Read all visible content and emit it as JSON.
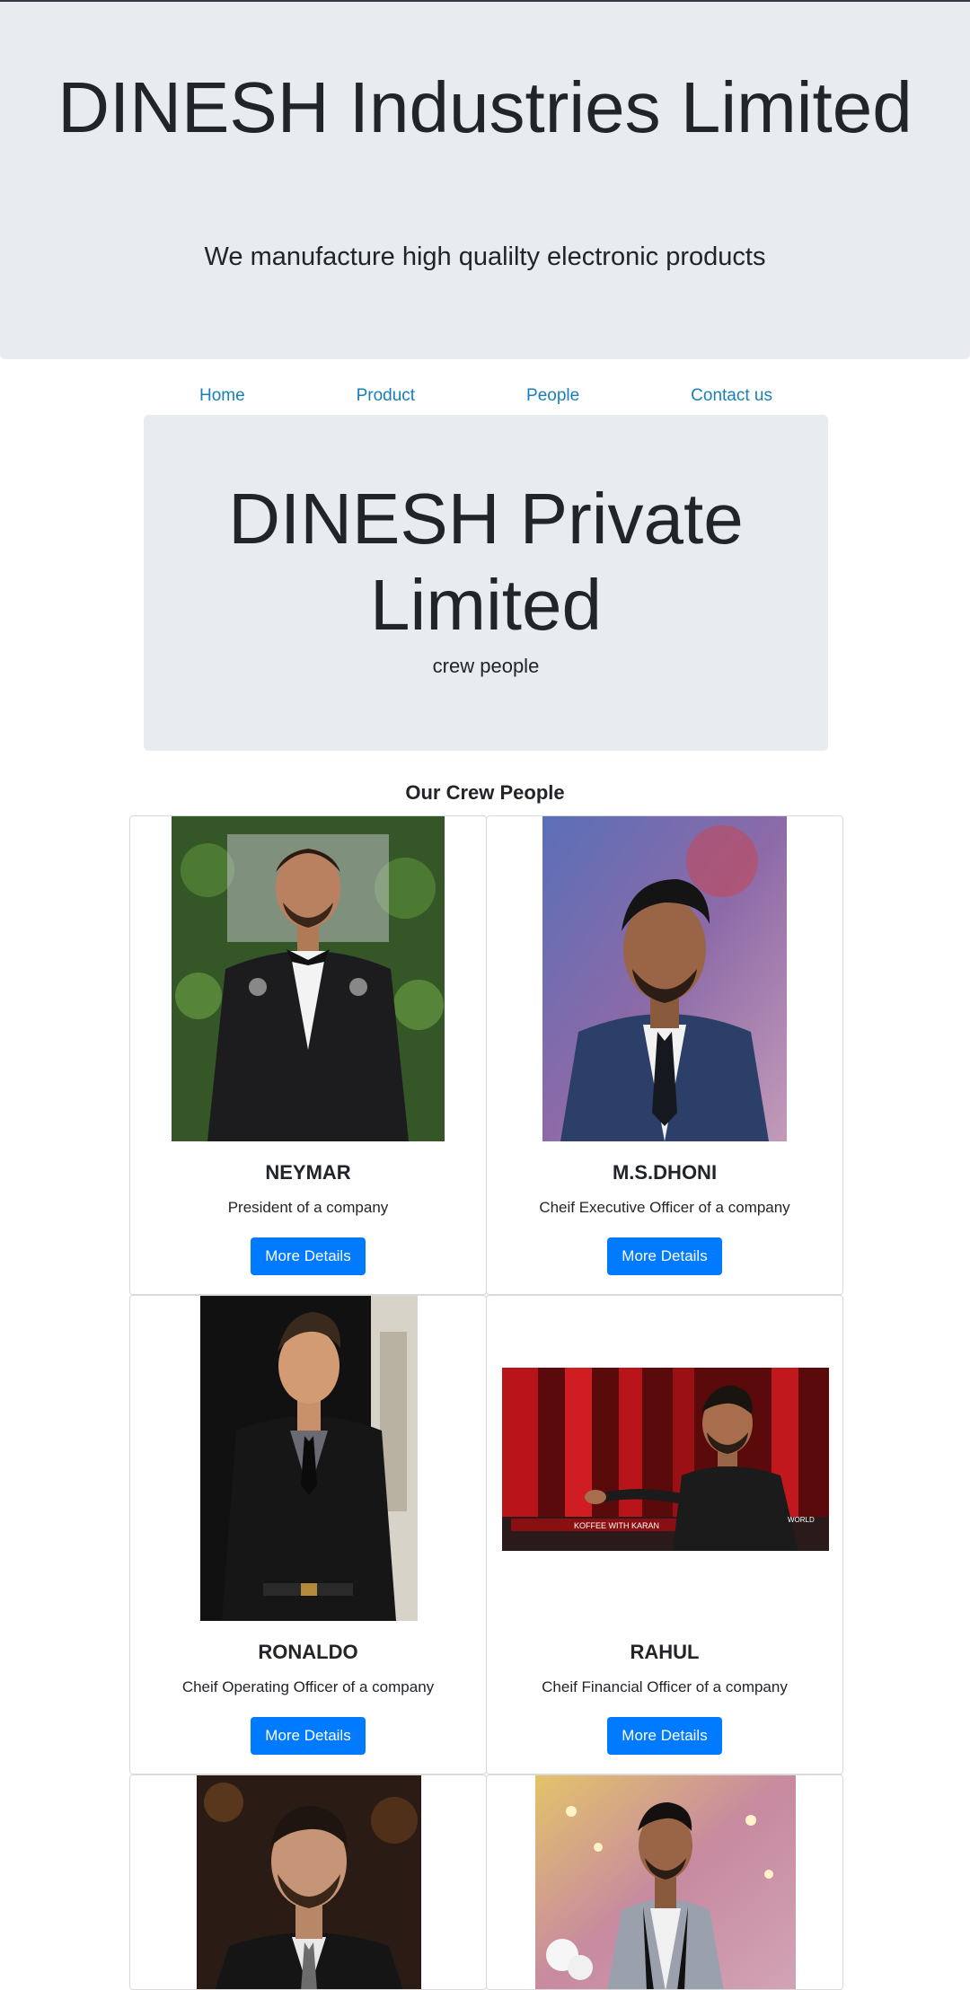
{
  "header": {
    "title": "DINESH Industries Limited",
    "tagline": "We manufacture high qualilty electronic products"
  },
  "nav": {
    "items": [
      "Home",
      "Product",
      "People",
      "Contact us"
    ]
  },
  "banner": {
    "title": "DINESH Private Limited",
    "subtitle": "crew people"
  },
  "crew": {
    "heading": "Our Crew People",
    "members": [
      {
        "name": "NEYMAR",
        "role": "President of a company",
        "button": "More Details"
      },
      {
        "name": "M.S.DHONI",
        "role": "Cheif Executive Officer of a company",
        "button": "More Details"
      },
      {
        "name": "RONALDO",
        "role": "Cheif Operating Officer of a company",
        "button": "More Details"
      },
      {
        "name": "RAHUL",
        "role": "Cheif Financial Officer of a company",
        "button": "More Details"
      }
    ]
  },
  "colors": {
    "jumbotron_bg": "#e9ecef",
    "link": "#1a7fb8",
    "button": "#007bff"
  }
}
